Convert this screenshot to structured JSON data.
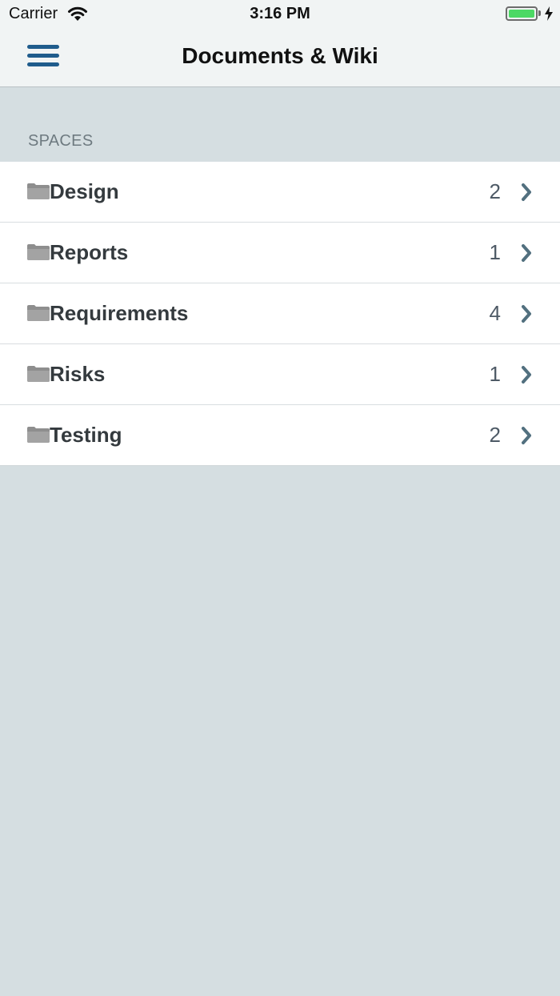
{
  "status_bar": {
    "carrier": "Carrier",
    "time": "3:16 PM",
    "battery_level": 1.0
  },
  "nav": {
    "title": "Documents & Wiki",
    "menu_icon": "hamburger-menu-icon"
  },
  "spaces": {
    "header": "SPACES",
    "items": [
      {
        "label": "Design",
        "count": "2"
      },
      {
        "label": "Reports",
        "count": "1"
      },
      {
        "label": "Requirements",
        "count": "4"
      },
      {
        "label": "Risks",
        "count": "1"
      },
      {
        "label": "Testing",
        "count": "2"
      }
    ]
  },
  "colors": {
    "accent": "#1f5c8c",
    "background": "#d5dee1",
    "chevron": "#52707f",
    "folder": "#8e8e8e",
    "battery": "#4cd964"
  }
}
